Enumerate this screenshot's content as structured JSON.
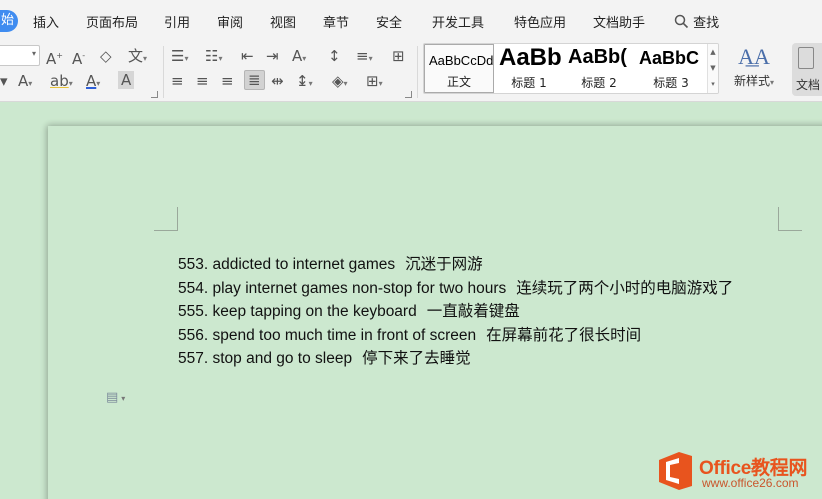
{
  "menu": {
    "start_label": "始",
    "items": [
      "插入",
      "页面布局",
      "引用",
      "审阅",
      "视图",
      "章节",
      "安全",
      "开发工具",
      "特色应用",
      "文档助手"
    ],
    "search_label": "查找"
  },
  "ribbon": {
    "styles": [
      {
        "preview": "AaBbCcDd",
        "label": "正文"
      },
      {
        "preview": "AaBb",
        "label": "标题 1"
      },
      {
        "preview": "AaBb(",
        "label": "标题 2"
      },
      {
        "preview": "AaBbC",
        "label": "标题 3"
      }
    ],
    "new_style_label": "新样式",
    "doc_assistant_label": "文档"
  },
  "document": {
    "lines": [
      {
        "en": "553. addicted to internet games",
        "zh": "沉迷于网游"
      },
      {
        "en": "554. play internet games non-stop for two hours",
        "zh": "连续玩了两个小时的电脑游戏了"
      },
      {
        "en": "555. keep tapping on the keyboard",
        "zh": "一直敲着键盘"
      },
      {
        "en": "556. spend too much time in front of screen",
        "zh": "在屏幕前花了很长时间"
      },
      {
        "en": "557. stop and go to sleep",
        "zh": "停下来了去睡觉"
      }
    ]
  },
  "watermark": {
    "brand": "Office教程网",
    "site": "www.office26.com"
  },
  "colors": {
    "document_background": "#cce8cf",
    "toolbar_background": "#f3f3f3",
    "start_tab": "#3f8cf0",
    "logo_orange": "#e8541e"
  }
}
